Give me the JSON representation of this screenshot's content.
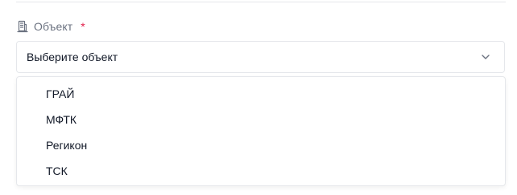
{
  "field": {
    "label": "Объект",
    "required_mark": "*",
    "icon": "building-icon"
  },
  "select": {
    "selected_value": "Выберите объект",
    "icon": "chevron-down-icon"
  },
  "dropdown": {
    "options": [
      {
        "label": "ГРАЙ"
      },
      {
        "label": "МФТК"
      },
      {
        "label": "Регикон"
      },
      {
        "label": "ТСК"
      }
    ]
  },
  "colors": {
    "label_text": "#6b7280",
    "required": "#e11d48",
    "border": "#e5e7eb",
    "text": "#111827"
  }
}
